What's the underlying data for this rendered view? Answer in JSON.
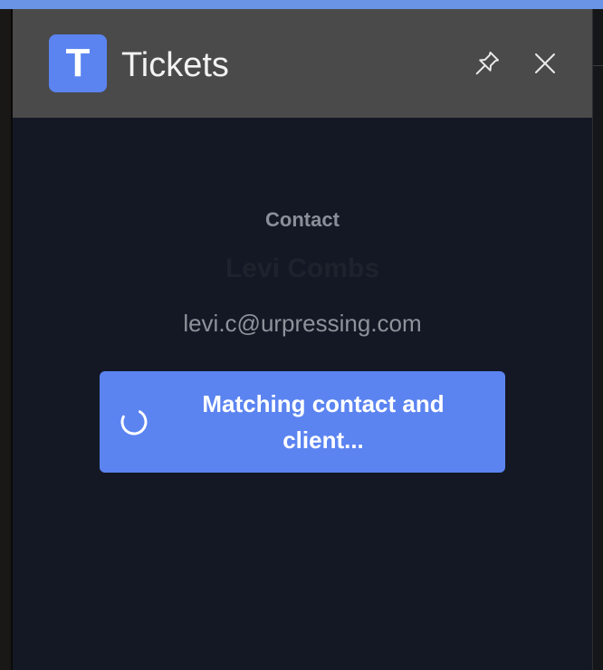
{
  "app": {
    "logo_letter": "T",
    "title": "Tickets"
  },
  "header_icons": {
    "pin": "pin-icon",
    "close": "close-icon"
  },
  "contact": {
    "label": "Contact",
    "name": "Levi Combs",
    "email": "levi.c@urpressing.com"
  },
  "action": {
    "label": "Matching contact and client...",
    "icon": "spinner-icon"
  },
  "colors": {
    "accent": "#5b84f1",
    "panel_bg": "#141824",
    "header_bg": "#4a4a4a",
    "top_bar": "#6a94e6"
  }
}
